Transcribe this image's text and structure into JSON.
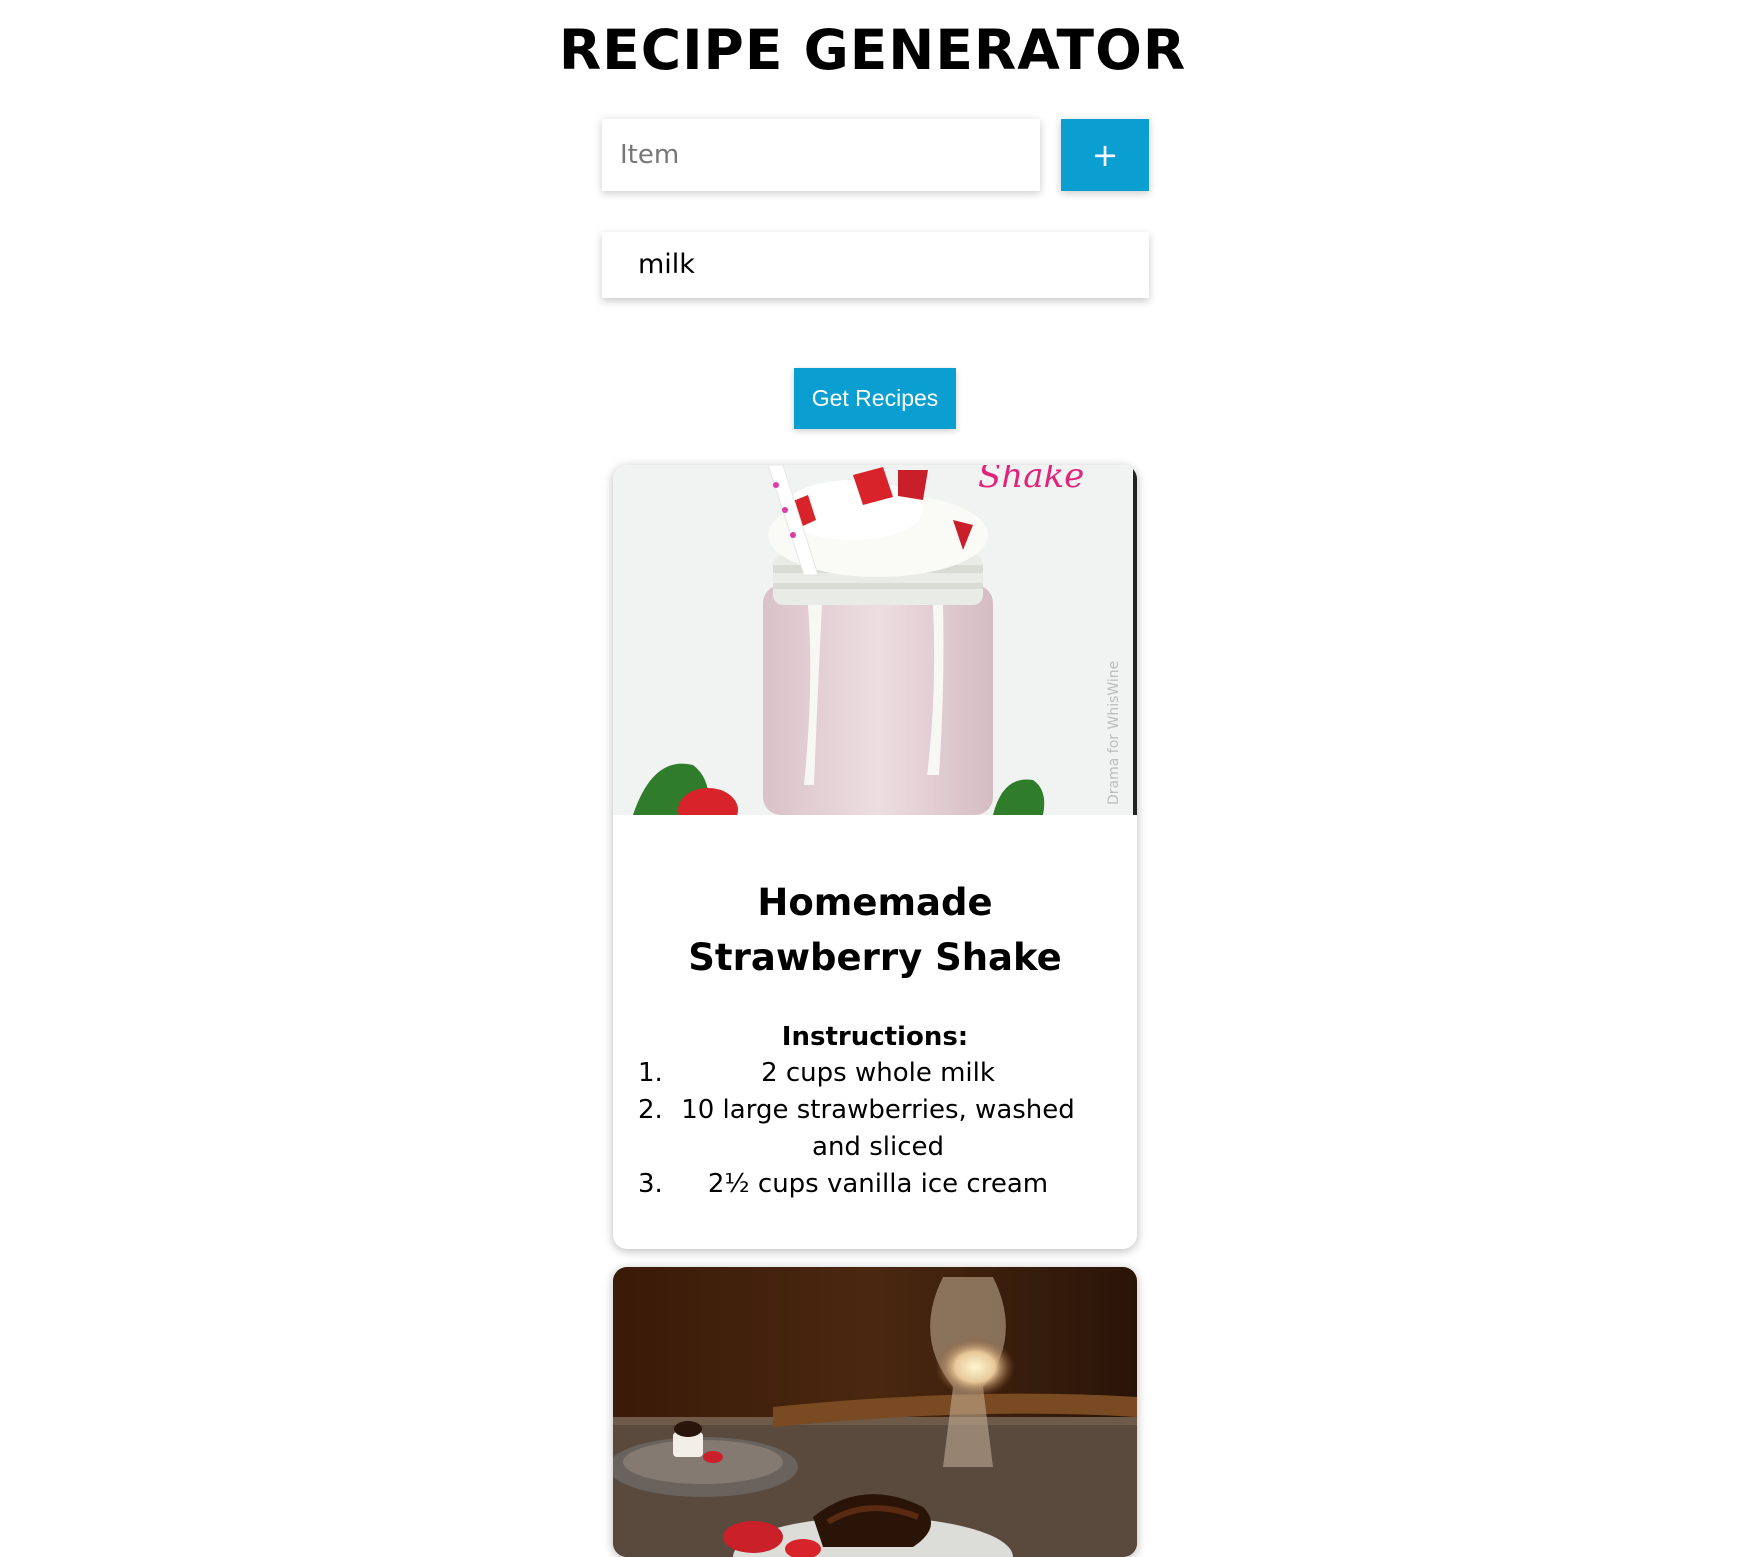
{
  "header": {
    "title": "RECIPE GENERATOR"
  },
  "form": {
    "item_placeholder": "Item",
    "item_value": "",
    "add_label": "+"
  },
  "ingredients": [
    "milk"
  ],
  "get_recipes_label": "Get Recipes",
  "colors": {
    "accent": "#0b9fd1"
  },
  "recipes": [
    {
      "image": "strawberry-shake-photo",
      "title": "Homemade Strawberry Shake",
      "instructions_heading": "Instructions:",
      "instructions": [
        {
          "num": "1.",
          "text": "2 cups whole milk"
        },
        {
          "num": "2.",
          "text": "10 large strawberries, washed and sliced"
        },
        {
          "num": "3.",
          "text": "2½ cups vanilla ice cream"
        }
      ]
    },
    {
      "image": "chocolate-dessert-photo"
    }
  ]
}
